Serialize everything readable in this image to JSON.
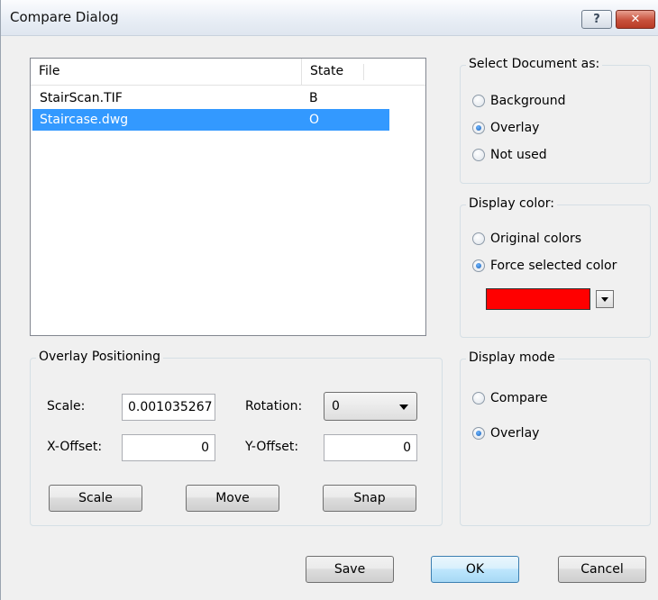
{
  "window": {
    "title": "Compare Dialog",
    "help_glyph": "?",
    "close_glyph": "✕"
  },
  "file_list": {
    "columns": [
      "File",
      "State"
    ],
    "rows": [
      {
        "file": "StairScan.TIF",
        "state": "B",
        "selected": false
      },
      {
        "file": "Staircase.dwg",
        "state": "O",
        "selected": true
      }
    ]
  },
  "select_document": {
    "label": "Select Document as:",
    "options": [
      "Background",
      "Overlay",
      "Not used"
    ],
    "selected": "Overlay"
  },
  "display_color": {
    "label": "Display color:",
    "options": [
      "Original colors",
      "Force selected color"
    ],
    "selected": "Force selected color",
    "swatch_color": "#ff0000"
  },
  "display_mode": {
    "label": "Display mode",
    "options": [
      "Compare",
      "Overlay"
    ],
    "selected": "Overlay"
  },
  "overlay_positioning": {
    "label": "Overlay Positioning",
    "scale_label": "Scale:",
    "scale_value": "0.001035267",
    "rotation_label": "Rotation:",
    "rotation_value": "0",
    "x_offset_label": "X-Offset:",
    "x_offset_value": "0",
    "y_offset_label": "Y-Offset:",
    "y_offset_value": "0",
    "buttons": [
      "Scale",
      "Move",
      "Snap"
    ]
  },
  "footer": {
    "save_label": "Save",
    "ok_label": "OK",
    "cancel_label": "Cancel"
  },
  "colors": {
    "selection": "#3399ff",
    "swatch": "#ff0000"
  }
}
